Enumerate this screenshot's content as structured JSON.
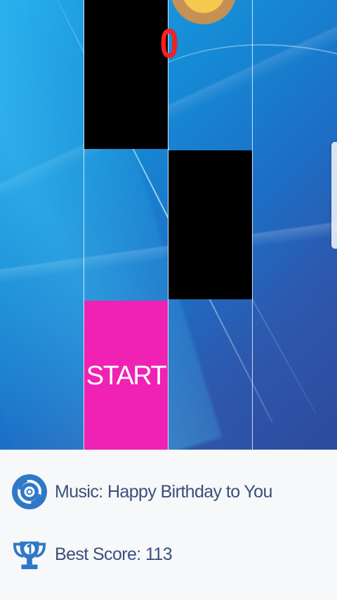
{
  "game": {
    "score": "0",
    "start_label": "START"
  },
  "info": {
    "music": "Music: Happy Birthday to You",
    "best_score": "Best Score: 113"
  },
  "icons": {
    "music": "disc-icon",
    "best_score": "trophy-icon",
    "side": "side-handle"
  },
  "colors": {
    "score": "#ff1d1d",
    "start_tile": "#ef22b3",
    "black_tile": "#000000",
    "info_text": "#3a4f7c",
    "icon_blue": "#2f78c8"
  }
}
